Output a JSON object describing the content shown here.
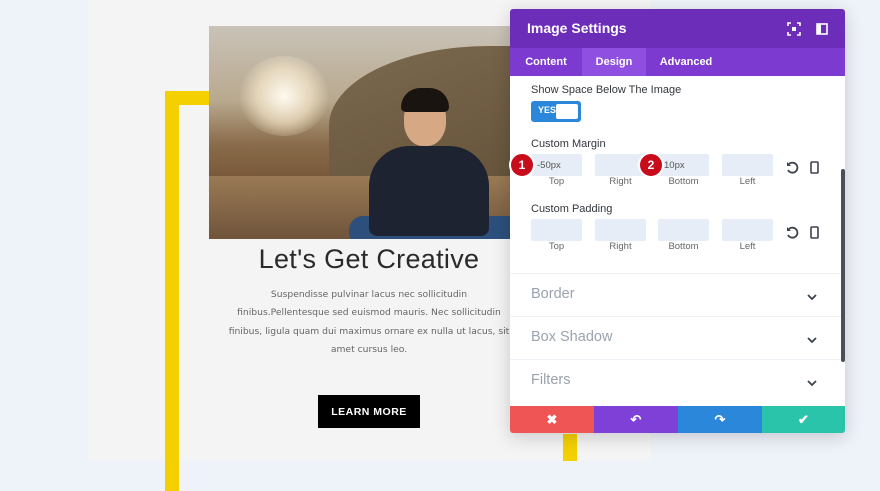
{
  "content": {
    "heading": "Let's Get Creative",
    "paragraph": [
      "Suspendisse pulvinar lacus nec sollicitudin",
      "finibus.Pellentesque sed euismod mauris. Nec sollicitudin",
      "finibus, ligula quam dui maximus ornare ex nulla ut lacus, sit",
      "amet cursus leo."
    ],
    "button_label": "LEARN MORE"
  },
  "panel": {
    "title": "Image Settings",
    "header_icons": [
      "fullscreen-icon",
      "sidebar-toggle-icon"
    ],
    "tabs": [
      {
        "label": "Content",
        "active": false
      },
      {
        "label": "Design",
        "active": true
      },
      {
        "label": "Advanced",
        "active": false
      }
    ],
    "show_space_label": "Show Space Below The Image",
    "toggle_label": "YES",
    "custom_margin": {
      "label": "Custom Margin",
      "values": [
        "-50px",
        "",
        "10px",
        ""
      ],
      "sublabels": [
        "Top",
        "Right",
        "Bottom",
        "Left"
      ]
    },
    "custom_padding": {
      "label": "Custom Padding",
      "values": [
        "",
        "",
        "",
        ""
      ],
      "sublabels": [
        "Top",
        "Right",
        "Bottom",
        "Left"
      ]
    },
    "markers": [
      "1",
      "2"
    ],
    "sections": [
      "Border",
      "Box Shadow",
      "Filters"
    ],
    "actions": [
      {
        "name": "cancel",
        "glyph": "✖",
        "color": "#ef5555"
      },
      {
        "name": "undo",
        "glyph": "↶",
        "color": "#7f40d8"
      },
      {
        "name": "redo",
        "glyph": "↷",
        "color": "#2b87da"
      },
      {
        "name": "save",
        "glyph": "✔",
        "color": "#29c4a9"
      }
    ]
  },
  "colors": {
    "accent_yellow": "#f4d000",
    "panel_purple": "#6c2eb9",
    "tab_purple": "#7d3ad1"
  }
}
